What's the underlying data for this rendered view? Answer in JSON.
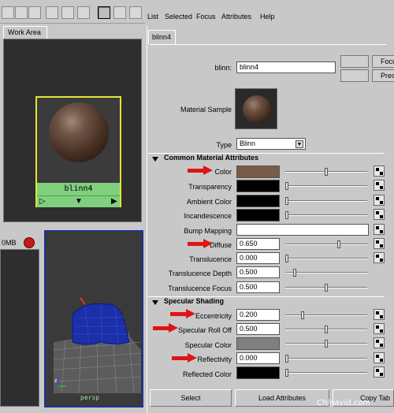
{
  "menu": [
    "List",
    "Selected",
    "Focus",
    "Attributes",
    "Help"
  ],
  "work_area": {
    "tab": "Work Area",
    "swatch_name": "blinn4"
  },
  "left_bottom": {
    "label": "0MB"
  },
  "viewport": {
    "label": "persp"
  },
  "editor": {
    "tab": "blinn4",
    "node_label": "blinn:",
    "node_value": "blinn4",
    "focus_button": "Focu",
    "presets_button": "Pres",
    "material_sample_label": "Material Sample",
    "type_label": "Type",
    "type_value": "Blinn",
    "section_common": "Common Material Attributes",
    "section_specular": "Specular Shading",
    "attrs": {
      "color": "Color",
      "transparency": "Transparency",
      "ambient": "Ambient Color",
      "incandescence": "Incandescence",
      "bump": "Bump Mapping",
      "diffuse": "Diffuse",
      "diffuse_value": "0.650",
      "translucence": "Translucence",
      "translucence_value": "0.000",
      "transl_depth": "Translucence Depth",
      "transl_depth_value": "0.500",
      "transl_focus": "Translucence Focus",
      "transl_focus_value": "0.500",
      "eccentricity": "Eccentricity",
      "eccentricity_value": "0.200",
      "rolloff": "Specular Roll Off",
      "rolloff_value": "0.500",
      "spec_color": "Specular Color",
      "reflectivity": "Reflectivity",
      "reflectivity_value": "0.000",
      "reflected_color": "Reflected Color"
    },
    "colors": {
      "color": "#7a5a48",
      "transparency": "#000000",
      "ambient": "#000000",
      "incandescence": "#000000",
      "spec_color": "#808080",
      "reflected_color": "#000000"
    }
  },
  "buttons": {
    "select": "Select",
    "load": "Load Attributes",
    "copy": "Copy Tab"
  },
  "watermark": "Chinavid.com"
}
